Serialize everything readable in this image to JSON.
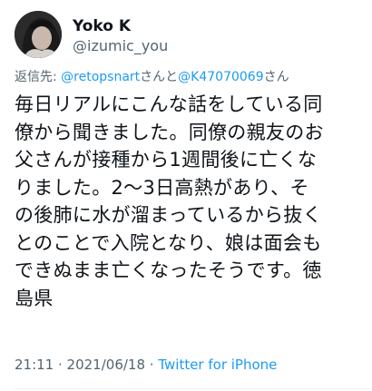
{
  "author": {
    "name": "Yoko K",
    "handle": "@izumic_you"
  },
  "reply": {
    "prefix": "返信先: ",
    "mention_1": "@retopsnart",
    "joiner": "さんと",
    "mention_2": "@K47070069",
    "suffix": "さん"
  },
  "body_lines": [
    "毎日リアルにこんな話をしている同",
    "僚から聞きました。同僚の親友のお",
    "父さんが接種から1週間後に亡くな",
    "りました。2〜3日高熱があり、そ",
    "の後肺に水が溜まっているから抜く",
    "とのことで入院となり、娘は面会も",
    "できぬまま亡くなったそうです。徳",
    "島県"
  ],
  "meta": {
    "time": "21:11",
    "separator_1": " · ",
    "date": "2021/06/18",
    "separator_2": " · ",
    "source": "Twitter for iPhone"
  },
  "colors": {
    "text": "#0f1419",
    "secondary": "#536471",
    "link": "#1d9bf0"
  }
}
